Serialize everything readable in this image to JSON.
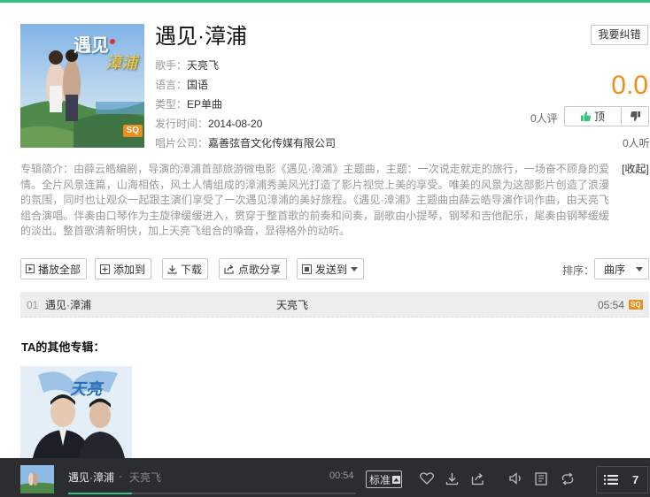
{
  "album": {
    "title": "遇见·漳浦",
    "cover_text": "遇见",
    "cover_text2": "漳浦",
    "cover_badge": "SQ",
    "singer_label": "歌手：",
    "singer": "天亮飞",
    "language_label": "语言：",
    "language": "国语",
    "type_label": "类型：",
    "type": "EP单曲",
    "release_label": "发行时间：",
    "release": "2014-08-20",
    "company_label": "唱片公司：",
    "company": "嘉善弦音文化传媒有限公司",
    "report_label": "我要纠错",
    "score": "0.0",
    "raters": "0人评",
    "upvote_label": "顶",
    "listeners": "0人听"
  },
  "description": {
    "label": "专辑简介：",
    "text": "由薛云皓编剧，导演的漳浦首部旅游微电影《遇见·漳浦》主题曲，主题：一次说走就走的旅行，一场奋不顾身的爱情。全片风景连篇，山海相依，风土人情组成的漳浦秀美风光打造了影片视觉上美的享受。唯美的风景为这部影片创造了浪漫的氛围，同时也让观众一起跟主演们享受了一次遇见漳浦的美好旅程。《遇见·漳浦》主题曲由薛云皓导演作词作曲，由天亮飞组合演唱。伴奏由口琴作为主旋律缓缓进入，贯穿于整首歌的前奏和间奏，副歌由小提琴，钢琴和吉他配乐，尾奏由钢琴缓缓的淡出。整首歌清新明快，加上天亮飞组合的嗓音，显得格外的动听。",
    "collapse_label": "[收起]"
  },
  "toolbar": {
    "play_all": "播放全部",
    "add_to": "添加到",
    "download": "下载",
    "share": "点歌分享",
    "send_to": "发送到",
    "sort_label": "排序：",
    "sort_value": "曲序"
  },
  "songs": [
    {
      "num": "01",
      "name": "遇见·漳浦",
      "artist": "天亮飞",
      "duration": "05:54",
      "badge": "SQ"
    }
  ],
  "other_albums": {
    "title": "TA的其他专辑：",
    "cover_text": "天亮"
  },
  "player": {
    "song": "遇见·漳浦",
    "separator": "-",
    "artist": "天亮飞",
    "time": "00:54",
    "progress": 0.22,
    "quality": "标准",
    "queue_count": "7"
  },
  "colors": {
    "accent": "#31c27c",
    "score": "#f08e1c",
    "player_bg": "#2c2d30"
  }
}
